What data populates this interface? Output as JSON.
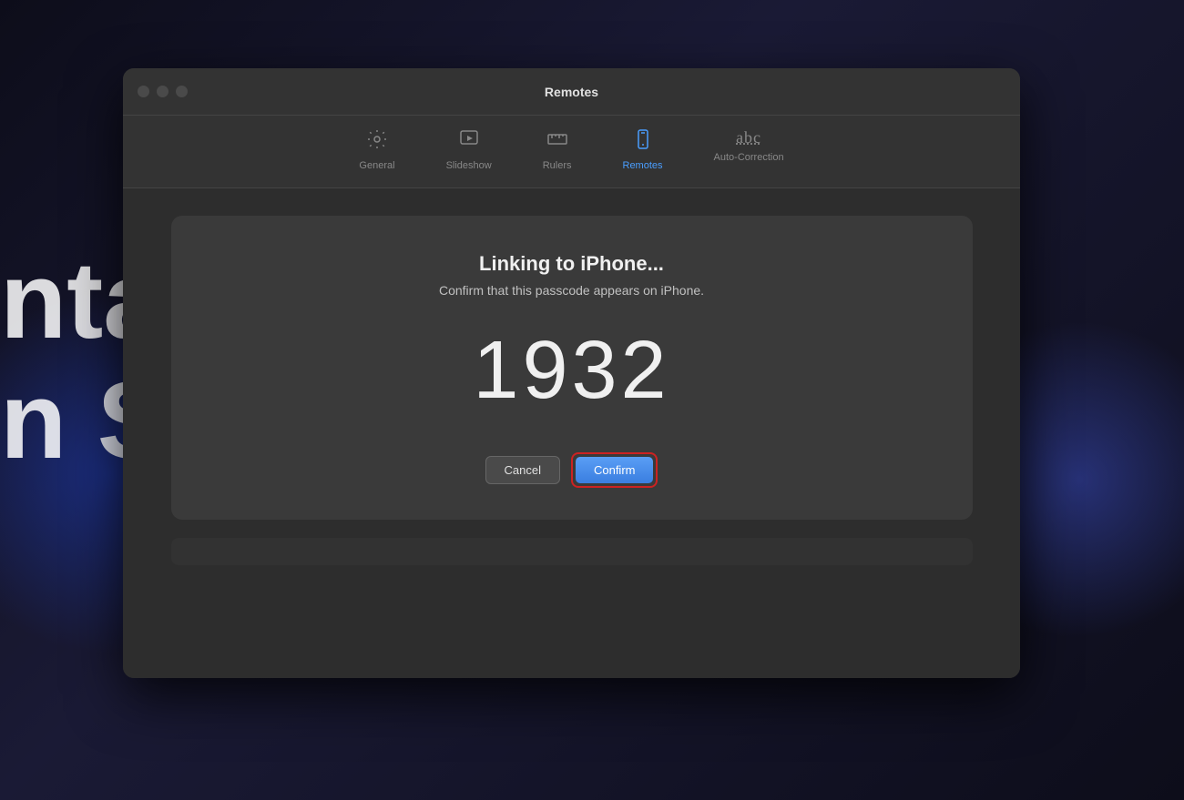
{
  "background": {
    "text_line1": "nta",
    "text_line2": "n Sub"
  },
  "window": {
    "title": "Remotes",
    "toolbar": {
      "items": [
        {
          "id": "general",
          "label": "General",
          "icon": "gear",
          "active": false
        },
        {
          "id": "slideshow",
          "label": "Slideshow",
          "icon": "play",
          "active": false
        },
        {
          "id": "rulers",
          "label": "Rulers",
          "icon": "rulers",
          "active": false
        },
        {
          "id": "remotes",
          "label": "Remotes",
          "icon": "phone",
          "active": true
        },
        {
          "id": "autocorrection",
          "label": "Auto-Correction",
          "icon": "abc",
          "active": false
        }
      ]
    }
  },
  "dialog": {
    "title": "Linking to iPhone...",
    "subtitle": "Confirm that this passcode appears on iPhone.",
    "passcode": "1932",
    "buttons": {
      "cancel_label": "Cancel",
      "confirm_label": "Confirm"
    }
  },
  "traffic_lights": {
    "close_label": "close",
    "minimize_label": "minimize",
    "maximize_label": "maximize"
  }
}
